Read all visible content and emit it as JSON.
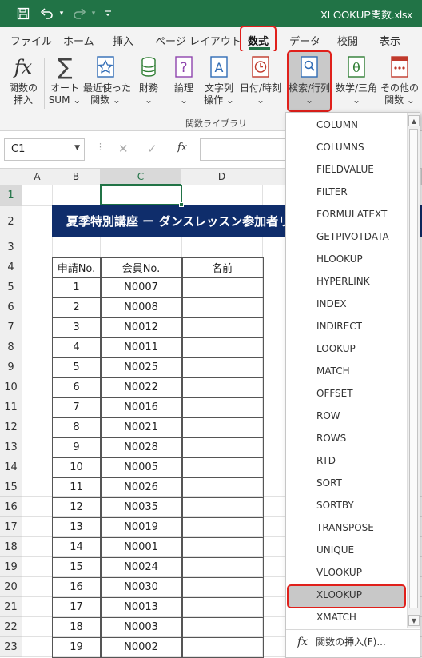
{
  "window": {
    "title": "XLOOKUP関数.xlsx"
  },
  "quick_access": [
    {
      "name": "save-icon",
      "glyph": "🖫"
    },
    {
      "name": "undo-icon",
      "glyph": "↶"
    },
    {
      "name": "undo-dropdown-icon",
      "glyph": "▾"
    },
    {
      "name": "redo-icon",
      "glyph": "↷"
    },
    {
      "name": "redo-dropdown-icon",
      "glyph": "▾"
    },
    {
      "name": "customize-qat-icon",
      "glyph": "⩡"
    }
  ],
  "tabs": [
    "ファイル",
    "ホーム",
    "挿入",
    "ページ レイアウト",
    "数式",
    "データ",
    "校閲",
    "表示"
  ],
  "active_tab": "数式",
  "ribbon": {
    "buttons": [
      {
        "line1": "関数の",
        "line2": "挿入",
        "icon": "insert-function-icon"
      },
      {
        "line1": "オート",
        "line2": "SUM ⌄",
        "icon": "autosum-icon"
      },
      {
        "line1": "最近使った",
        "line2": "関数 ⌄",
        "icon": "recent-functions-icon"
      },
      {
        "line1": "財務",
        "line2": "⌄",
        "icon": "financial-icon"
      },
      {
        "line1": "論理",
        "line2": "⌄",
        "icon": "logical-icon"
      },
      {
        "line1": "文字列",
        "line2": "操作 ⌄",
        "icon": "text-icon"
      },
      {
        "line1": "日付/時刻",
        "line2": "⌄",
        "icon": "date-time-icon"
      },
      {
        "line1": "検索/行列",
        "line2": "⌄",
        "icon": "lookup-reference-icon"
      },
      {
        "line1": "数学/三角",
        "line2": "⌄",
        "icon": "math-trig-icon"
      },
      {
        "line1": "その他の",
        "line2": "関数 ⌄",
        "icon": "more-functions-icon"
      }
    ],
    "group_label": "関数ライブラリ"
  },
  "formula_bar": {
    "name_box": "C1",
    "cancel": "✕",
    "enter": "✓",
    "fx": "fx",
    "value": ""
  },
  "columns": [
    "A",
    "B",
    "C",
    "D"
  ],
  "selected_column": "C",
  "rows": [
    "1",
    "2",
    "3",
    "4",
    "5",
    "6",
    "7",
    "8",
    "9",
    "10",
    "11",
    "12",
    "13",
    "14",
    "15",
    "16",
    "17",
    "18",
    "19",
    "20",
    "21",
    "22",
    "23"
  ],
  "sheet": {
    "title": "夏季特別講座 ー ダンスレッスン参加者リ",
    "headers": {
      "apply_no": "申請No.",
      "member_no": "会員No.",
      "name": "名前"
    },
    "records": [
      {
        "no": "1",
        "member": "N0007"
      },
      {
        "no": "2",
        "member": "N0008"
      },
      {
        "no": "3",
        "member": "N0012"
      },
      {
        "no": "4",
        "member": "N0011"
      },
      {
        "no": "5",
        "member": "N0025"
      },
      {
        "no": "6",
        "member": "N0022"
      },
      {
        "no": "7",
        "member": "N0016"
      },
      {
        "no": "8",
        "member": "N0021"
      },
      {
        "no": "9",
        "member": "N0028"
      },
      {
        "no": "10",
        "member": "N0005"
      },
      {
        "no": "11",
        "member": "N0026"
      },
      {
        "no": "12",
        "member": "N0035"
      },
      {
        "no": "13",
        "member": "N0019"
      },
      {
        "no": "14",
        "member": "N0001"
      },
      {
        "no": "15",
        "member": "N0024"
      },
      {
        "no": "16",
        "member": "N0030"
      },
      {
        "no": "17",
        "member": "N0013"
      },
      {
        "no": "18",
        "member": "N0003"
      },
      {
        "no": "19",
        "member": "N0002"
      }
    ]
  },
  "dropdown": {
    "items": [
      "COLUMN",
      "COLUMNS",
      "FIELDVALUE",
      "FILTER",
      "FORMULATEXT",
      "GETPIVOTDATA",
      "HLOOKUP",
      "HYPERLINK",
      "INDEX",
      "INDIRECT",
      "LOOKUP",
      "MATCH",
      "OFFSET",
      "ROW",
      "ROWS",
      "RTD",
      "SORT",
      "SORTBY",
      "TRANSPOSE",
      "UNIQUE",
      "VLOOKUP",
      "XLOOKUP",
      "XMATCH"
    ],
    "highlighted": "XLOOKUP",
    "insert_function": "関数の挿入(F)..."
  },
  "annotation_color": "#e0201b",
  "accent_color": "#217346",
  "title_band_color": "#0f2d6b"
}
